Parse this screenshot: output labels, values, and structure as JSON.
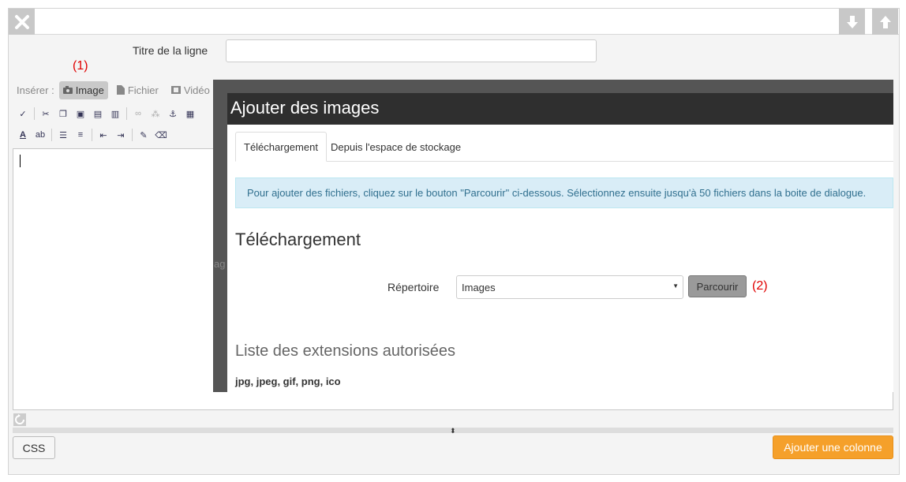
{
  "form": {
    "title_label": "Titre de la ligne",
    "title_value": "",
    "annotation_1": "(1)",
    "annotation_2": "(2)"
  },
  "insert": {
    "label": "Insérer :",
    "items": [
      "Image",
      "Fichier",
      "Vidéo"
    ]
  },
  "overlay_ghost": {
    "text1": "ag"
  },
  "modal": {
    "title": "Ajouter des images",
    "tabs": [
      "Téléchargement",
      "Depuis l'espace de stockage"
    ],
    "info": "Pour ajouter des fichiers, cliquez sur le bouton \"Parcourir\" ci-dessous. Sélectionnez ensuite jusqu'à 50 fichiers dans la boite de dialogue.",
    "section_title": "Téléchargement",
    "directory_label": "Répertoire",
    "directory_value": "Images",
    "browse_label": "Parcourir",
    "ext_title": "Liste des extensions autorisées",
    "ext_list": "jpg, jpeg, gif, png, ico"
  },
  "footer": {
    "css_label": "CSS",
    "add_column_label": "Ajouter une colonne"
  },
  "colors": {
    "accent_orange": "#f5a02a",
    "annotation_red": "#e00000",
    "modal_header": "#2f2f2f",
    "info_bg": "#d9edf7"
  }
}
